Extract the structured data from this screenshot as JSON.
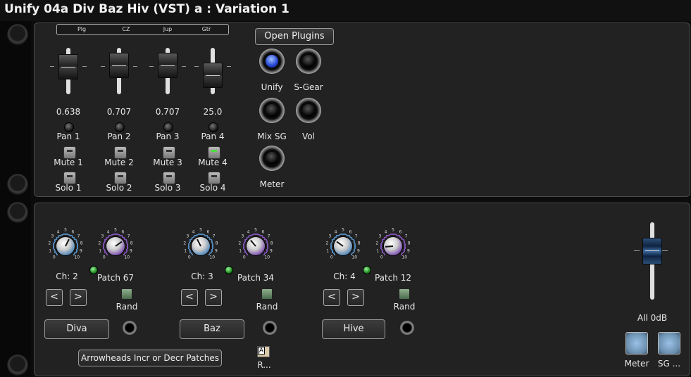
{
  "title": "Unify 04a Div Baz Hiv (VST) a : Variation 1",
  "top_panel": {
    "strip_labels": [
      "Plg",
      "CZ",
      "Jup",
      "Gtr"
    ],
    "faders": [
      {
        "value": "0.638",
        "level": 0.62
      },
      {
        "value": "0.707",
        "level": 0.7
      },
      {
        "value": "0.707",
        "level": 0.7
      },
      {
        "value": "25.0",
        "level": 0.25
      }
    ],
    "pans": [
      "Pan 1",
      "Pan 2",
      "Pan 3",
      "Pan 4"
    ],
    "mutes": [
      {
        "label": "Mute 1",
        "on": false
      },
      {
        "label": "Mute 2",
        "on": false
      },
      {
        "label": "Mute 3",
        "on": false
      },
      {
        "label": "Mute 4",
        "on": true
      }
    ],
    "solos": [
      {
        "label": "Solo 1",
        "on": false
      },
      {
        "label": "Solo 2",
        "on": false
      },
      {
        "label": "Solo 3",
        "on": false
      },
      {
        "label": "Solo 4",
        "on": false
      }
    ],
    "open_plugins_label": "Open Plugins",
    "round_buttons": [
      {
        "label": "Unify",
        "on": true
      },
      {
        "label": "S-Gear",
        "on": false
      },
      {
        "label": "Mix SG",
        "on": false
      },
      {
        "label": "Vol",
        "on": false
      },
      {
        "label": "Meter",
        "on": false
      }
    ]
  },
  "bottom_panel": {
    "dial_numbers": [
      "0",
      "1",
      "2",
      "3",
      "4",
      "5",
      "6",
      "7",
      "8",
      "9",
      "10"
    ],
    "channels": [
      {
        "ch_label": "Ch: 2",
        "patch_label": "Patch 67",
        "rand_label": "Rand",
        "plugin_label": "Diva",
        "ch_value": 0.6,
        "patch_value": 0.7
      },
      {
        "ch_label": "Ch: 3",
        "patch_label": "Patch 34",
        "rand_label": "Rand",
        "plugin_label": "Baz",
        "ch_value": 0.4,
        "patch_value": 0.35
      },
      {
        "ch_label": "Ch: 4",
        "patch_label": "Patch 12",
        "rand_label": "Rand",
        "plugin_label": "Hive",
        "ch_value": 0.3,
        "patch_value": 0.15
      }
    ],
    "prev_label": "<",
    "next_label": ">",
    "arrowheads_label": "Arrowheads Incr or Decr Patches",
    "a_badge": "A",
    "r_label": "R...",
    "master_label": "All 0dB",
    "meter_label": "Meter",
    "sg_label": "SG ..."
  },
  "colors": {
    "panel_bg": "#222222",
    "ch_dial": "#4f86b8",
    "patch_dial": "#7d4fb0",
    "led_green": "#2ad12a"
  }
}
